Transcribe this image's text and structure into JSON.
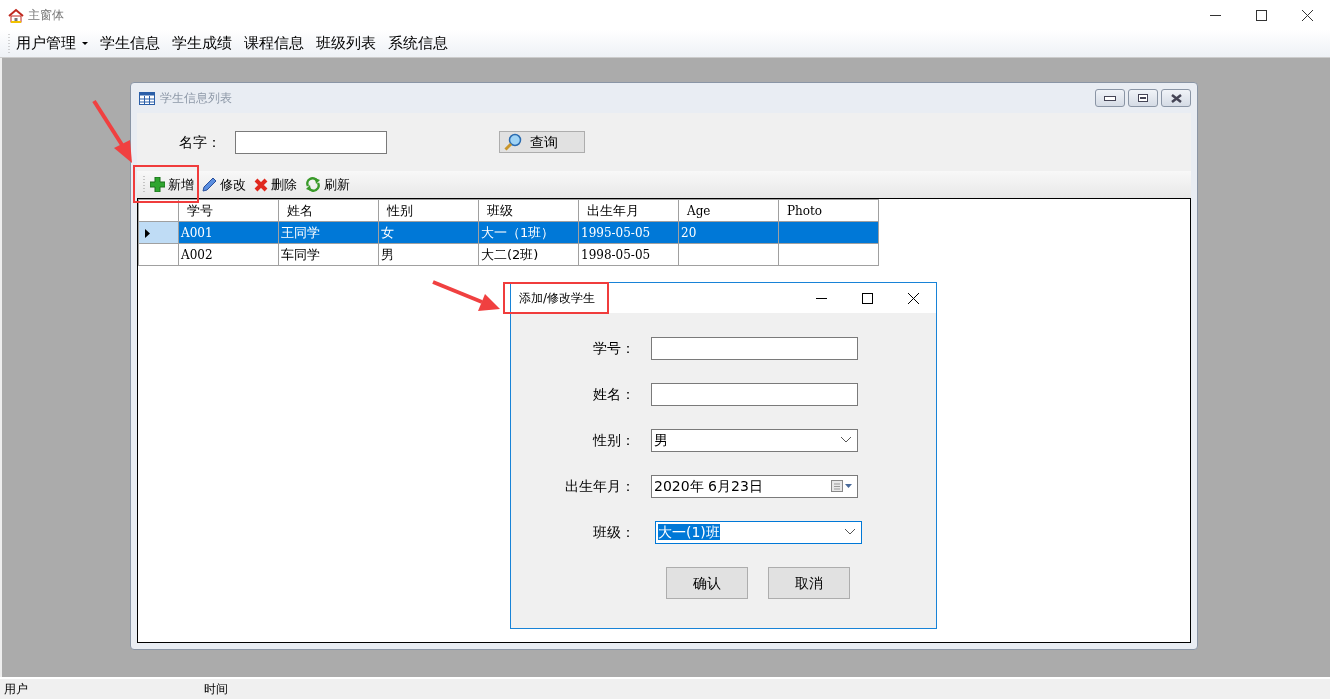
{
  "window": {
    "title": "主窗体"
  },
  "menu": [
    {
      "label": "用户管理",
      "dropdown": true
    },
    {
      "label": "学生信息",
      "dropdown": false
    },
    {
      "label": "学生成绩",
      "dropdown": false
    },
    {
      "label": "课程信息",
      "dropdown": false
    },
    {
      "label": "班级列表",
      "dropdown": false
    },
    {
      "label": "系统信息",
      "dropdown": false
    }
  ],
  "child_window": {
    "title": "学生信息列表",
    "search_label": "名字：",
    "query_button": "查询",
    "toolbar": [
      {
        "label": "新增",
        "kind": "add"
      },
      {
        "label": "修改",
        "kind": "edit"
      },
      {
        "label": "删除",
        "kind": "delete"
      },
      {
        "label": "刷新",
        "kind": "refresh"
      }
    ],
    "table": {
      "columns": [
        "学号",
        "姓名",
        "性别",
        "班级",
        "出生年月",
        "Age",
        "Photo"
      ],
      "rows": [
        {
          "selected": true,
          "cells": [
            "A001",
            "王同学",
            "女",
            "大一（1班）",
            "1995-05-05",
            "20",
            ""
          ]
        },
        {
          "selected": false,
          "cells": [
            "A002",
            "车同学",
            "男",
            "大二(2班)",
            "1998-05-05",
            "",
            ""
          ]
        }
      ]
    }
  },
  "dialog": {
    "title": "添加/修改学生",
    "fields": [
      {
        "label": "学号：",
        "kind": "text"
      },
      {
        "label": "姓名：",
        "kind": "text"
      },
      {
        "label": "性别：",
        "kind": "combo",
        "value": "男",
        "focused": false
      },
      {
        "label": "出生年月：",
        "kind": "date",
        "value": "2020年  6月23日"
      },
      {
        "label": "班级：",
        "kind": "combo",
        "value": "大一(1)班",
        "focused": true
      }
    ],
    "buttons": [
      "确认",
      "取消"
    ]
  },
  "status_bar": [
    "用户",
    "时间"
  ]
}
